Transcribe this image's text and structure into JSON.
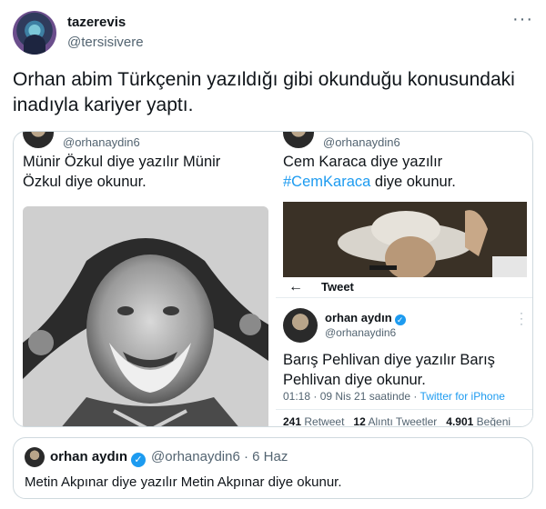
{
  "tweet": {
    "author_name": "tazerevis",
    "author_handle": "@tersisivere",
    "more_icon": "ellipsis-icon",
    "text": "Orhan abim Türkçenin yazıldığı gibi okunduğu konusundaki inadıyla kariyer yaptı."
  },
  "media": {
    "left": {
      "handle": "@orhanaydin6",
      "text": "Münir Özkul diye yazılır Münir Özkul diye okunur."
    },
    "right_top": {
      "handle": "@orhanaydin6",
      "text_before": "Cem Karaca diye yazılır",
      "hashtag": "#CemKaraca",
      "text_after": "diye okunur."
    },
    "right_bottom": {
      "screen_title": "Tweet",
      "back_icon": "arrow-left-icon",
      "name": "orhan aydın",
      "handle": "@orhanaydin6",
      "text": "Barış Pehlivan diye yazılır Barış Pehlivan diye okunur.",
      "time": "01:18 · 09 Nis 21 saatinde ·",
      "client": "Twitter for iPhone",
      "retweets_count": "241",
      "retweets_label": "Retweet",
      "quotes_count": "12",
      "quotes_label": "Alıntı Tweetler",
      "likes_count": "4.901",
      "likes_label": "Beğeni"
    }
  },
  "quote": {
    "name": "orhan aydın",
    "handle": "@orhanaydin6",
    "dot": "·",
    "date": "6 Haz",
    "text": "Metin Akpınar diye yazılır Metin Akpınar diye okunur."
  },
  "colors": {
    "accent": "#1d9bf0",
    "text": "#0f1419",
    "muted": "#536471",
    "border": "#cfd9de"
  }
}
